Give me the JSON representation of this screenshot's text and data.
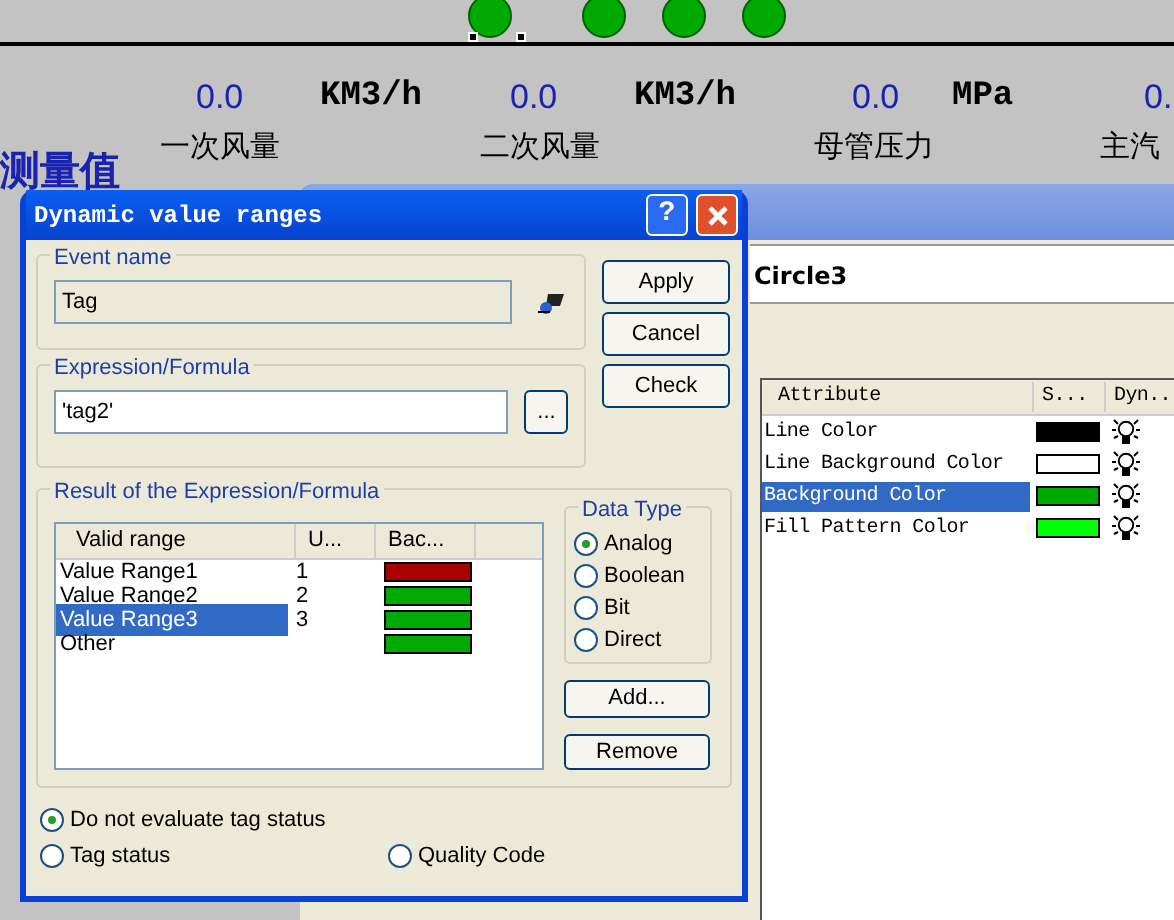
{
  "canvas": {
    "indicators": [
      {
        "color": "#00aa00",
        "selected": true
      },
      {
        "color": "#00aa00",
        "selected": false
      },
      {
        "color": "#00aa00",
        "selected": false
      },
      {
        "color": "#00aa00",
        "selected": false
      }
    ],
    "readouts": [
      {
        "value": "0.0",
        "unit": "KM3/h",
        "label": "一次风量"
      },
      {
        "value": "0.0",
        "unit": "KM3/h",
        "label": "二次风量"
      },
      {
        "value": "0.0",
        "unit": "MPa",
        "label": "母管压力"
      },
      {
        "value": "0.",
        "label": "主汽"
      }
    ],
    "heading": "测量值"
  },
  "properties_window": {
    "object_name": "Circle3",
    "columns": [
      "Attribute",
      "S...",
      "Dyn..."
    ],
    "rows": [
      {
        "attribute": "Line Color",
        "color": "#000000",
        "selected": false
      },
      {
        "attribute": "Line Background Color",
        "color": "#ffffff",
        "selected": false
      },
      {
        "attribute": "Background Color",
        "color": "#00aa00",
        "selected": true
      },
      {
        "attribute": "Fill Pattern Color",
        "color": "#00ff00",
        "selected": false
      }
    ]
  },
  "dialog": {
    "title": "Dynamic value ranges",
    "help": "?",
    "event_name": {
      "label": "Event name",
      "value": "Tag",
      "disabled": true
    },
    "expression": {
      "label": "Expression/Formula",
      "value": "'tag2'",
      "browse": "..."
    },
    "buttons": [
      "Apply",
      "Cancel",
      "Check"
    ],
    "result": {
      "label": "Result of the Expression/Formula",
      "columns": [
        "Valid range",
        "U...",
        "Bac..."
      ],
      "rows": [
        {
          "name": "Value Range1",
          "value": "1",
          "color": "#aa0000",
          "selected": false
        },
        {
          "name": "Value Range2",
          "value": "2",
          "color": "#00aa00",
          "selected": false
        },
        {
          "name": "Value Range3",
          "value": "3",
          "color": "#00aa00",
          "selected": true
        },
        {
          "name": "Other",
          "color": "#00aa00",
          "selected": false
        }
      ]
    },
    "data_type": {
      "label": "Data Type",
      "options": [
        {
          "label": "Analog",
          "selected": true
        },
        {
          "label": "Boolean",
          "selected": false
        },
        {
          "label": "Bit",
          "selected": false
        },
        {
          "label": "Direct",
          "selected": false
        }
      ]
    },
    "list_buttons": [
      "Add...",
      "Remove"
    ],
    "tag_status": [
      {
        "label": "Do not evaluate tag status",
        "selected": true
      },
      {
        "label": "Tag status",
        "selected": false
      },
      {
        "label": "Quality Code",
        "selected": false
      }
    ]
  }
}
